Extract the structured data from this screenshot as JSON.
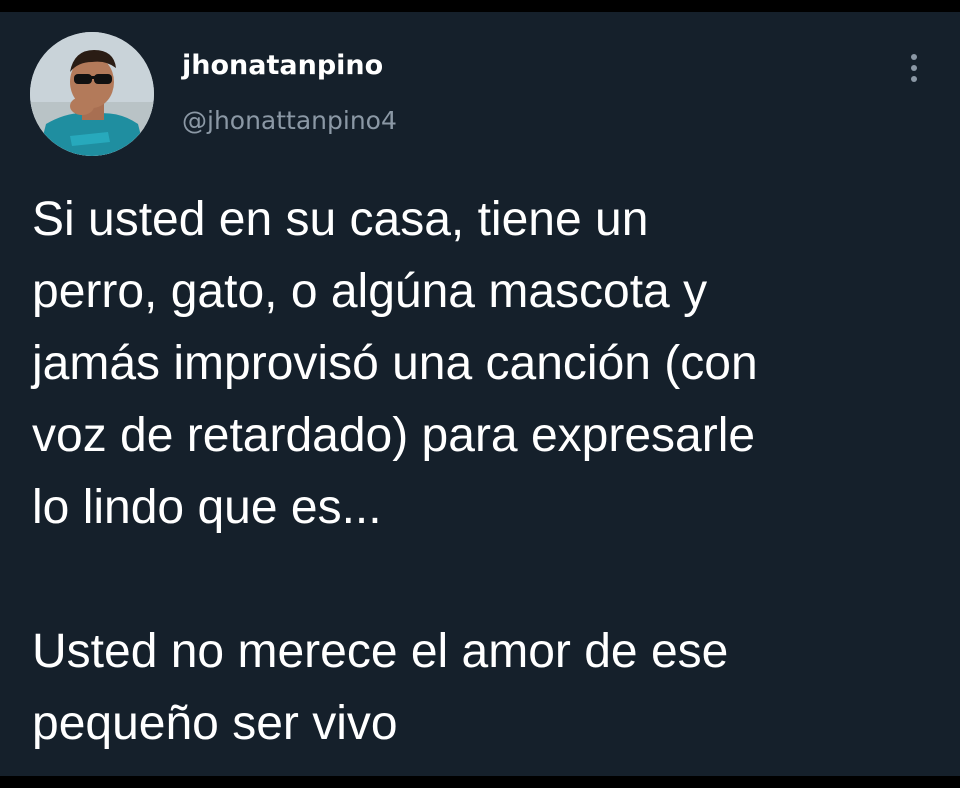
{
  "tweet": {
    "display_name": "jhonatanpino",
    "handle": "@jhonattanpino4",
    "more_icon": "more-vertical-icon",
    "avatar_icon": "user-avatar",
    "body_lines": [
      "Si usted en su casa, tiene un",
      "perro, gato, o algúna mascota y",
      "jamás improvisó una canción (con",
      "voz de retardado) para expresarle",
      "lo lindo que es..."
    ],
    "body_lines_2": [
      "Usted no merece el amor de ese",
      "pequeño ser vivo"
    ]
  },
  "colors": {
    "background": "#15202b",
    "text_primary": "#ffffff",
    "text_secondary": "#8b98a5",
    "frame": "#000000"
  }
}
